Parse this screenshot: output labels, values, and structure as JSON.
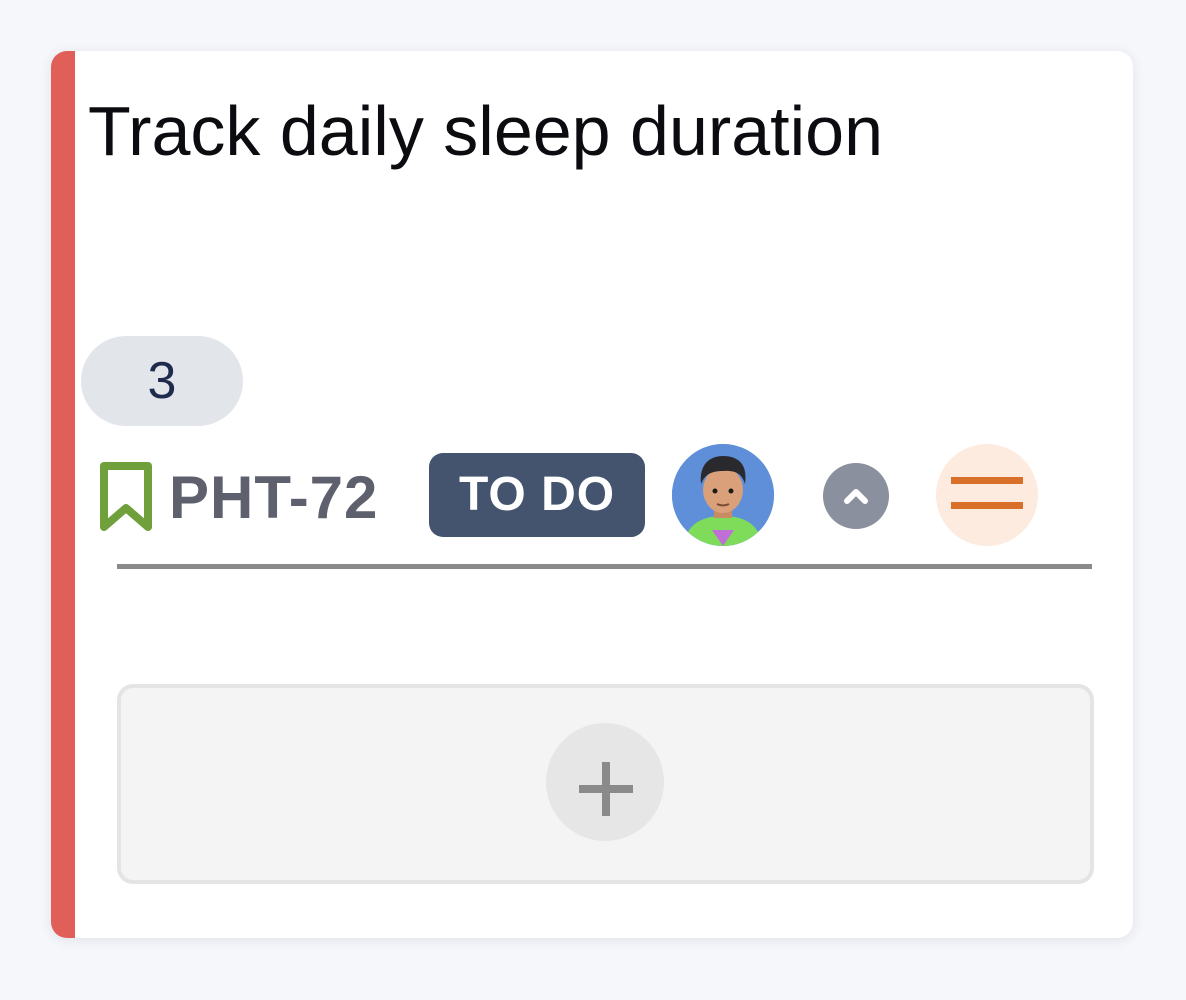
{
  "card": {
    "title": "Track daily sleep duration",
    "story_points": "3",
    "issue_key": "PHT-72",
    "status": "TO DO",
    "accent_color": "#e05f59",
    "issue_type_icon": "bookmark-icon",
    "issue_type_color": "#6fa03c",
    "priority_icon": "priority-medium-icon",
    "priority_color": "#d8702a",
    "collapse_icon": "chevron-up-icon",
    "add_icon": "plus-icon"
  }
}
